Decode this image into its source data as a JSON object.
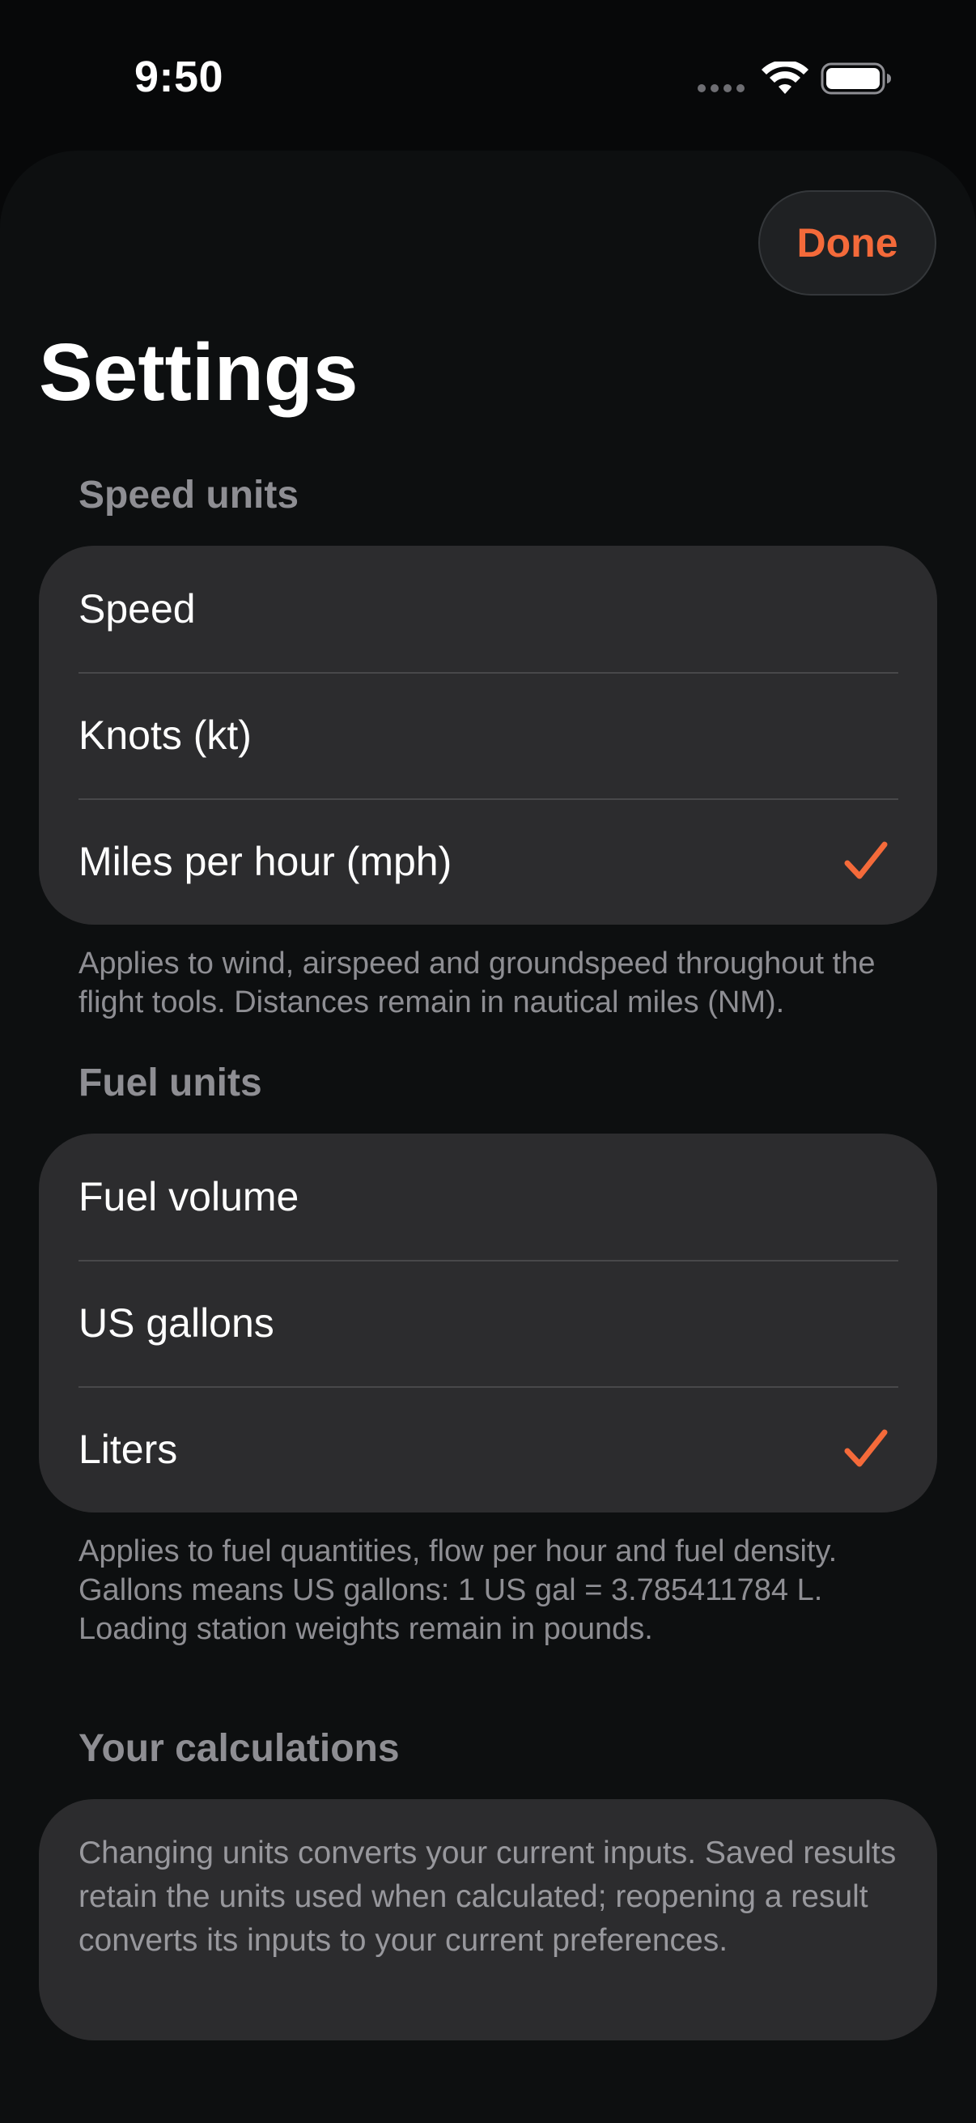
{
  "status_bar": {
    "time": "9:50"
  },
  "header": {
    "done_label": "Done",
    "title": "Settings"
  },
  "speed_section": {
    "header": "Speed units",
    "rows": [
      {
        "label": "Speed",
        "selected": false
      },
      {
        "label": "Knots (kt)",
        "selected": false
      },
      {
        "label": "Miles per hour (mph)",
        "selected": true
      }
    ],
    "footer": "Applies to wind, airspeed and groundspeed throughout the flight tools. Distances remain in nautical miles (NM)."
  },
  "fuel_section": {
    "header": "Fuel units",
    "rows": [
      {
        "label": "Fuel volume",
        "selected": false
      },
      {
        "label": "US gallons",
        "selected": false
      },
      {
        "label": "Liters",
        "selected": true
      }
    ],
    "footer": "Applies to fuel quantities, flow per hour and fuel density. Gallons means US gallons: 1 US gal = 3.785411784 L. Loading station weights remain in pounds."
  },
  "calculations_section": {
    "header": "Your calculations",
    "body": "Changing units converts your current inputs. Saved results retain the units used when calculated; reopening a result converts its inputs to your current preferences."
  },
  "icons": {
    "checkmark": "checkmark-icon",
    "wifi": "wifi-icon",
    "battery": "battery-icon"
  },
  "colors": {
    "accent": "#f46a3a",
    "background": "#070809",
    "sheet": "#0d0f10",
    "group": "#2c2c2e",
    "secondary_text": "#8e8e93"
  }
}
